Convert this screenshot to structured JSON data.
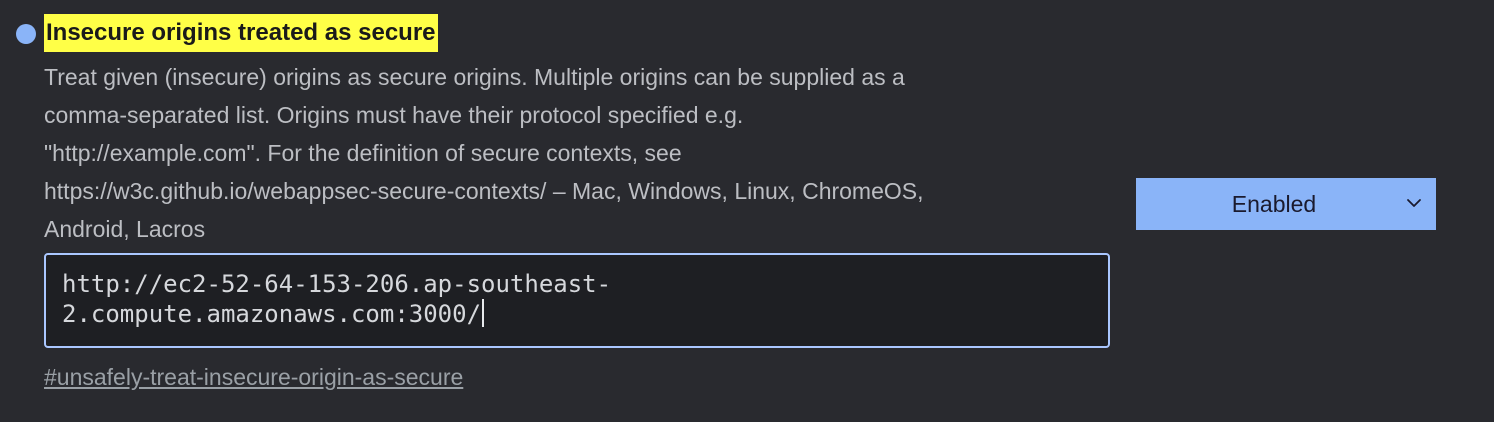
{
  "flag": {
    "title": "Insecure origins treated as secure",
    "description_lines": [
      "Treat given (insecure) origins as secure origins. Multiple origins can be supplied as a",
      "comma-separated list. Origins must have their protocol specified e.g.",
      "\"http://example.com\". For the definition of secure contexts, see",
      "https://w3c.github.io/webappsec-secure-contexts/ – Mac, Windows, Linux, ChromeOS,",
      "Android, Lacros"
    ],
    "input_lines": [
      "http://ec2-52-64-153-206.ap-southeast-",
      "2.compute.amazonaws.com:3000/"
    ],
    "link": "#unsafely-treat-insecure-origin-as-secure",
    "select_value": "Enabled"
  },
  "icons": {
    "status_dot": "modified-indicator-dot",
    "select_chevron": "chevron-down-icon"
  },
  "colors": {
    "background": "#292a2f",
    "highlight": "#ffff47",
    "accent": "#8ab4f8",
    "input_border": "#aac7ff"
  }
}
